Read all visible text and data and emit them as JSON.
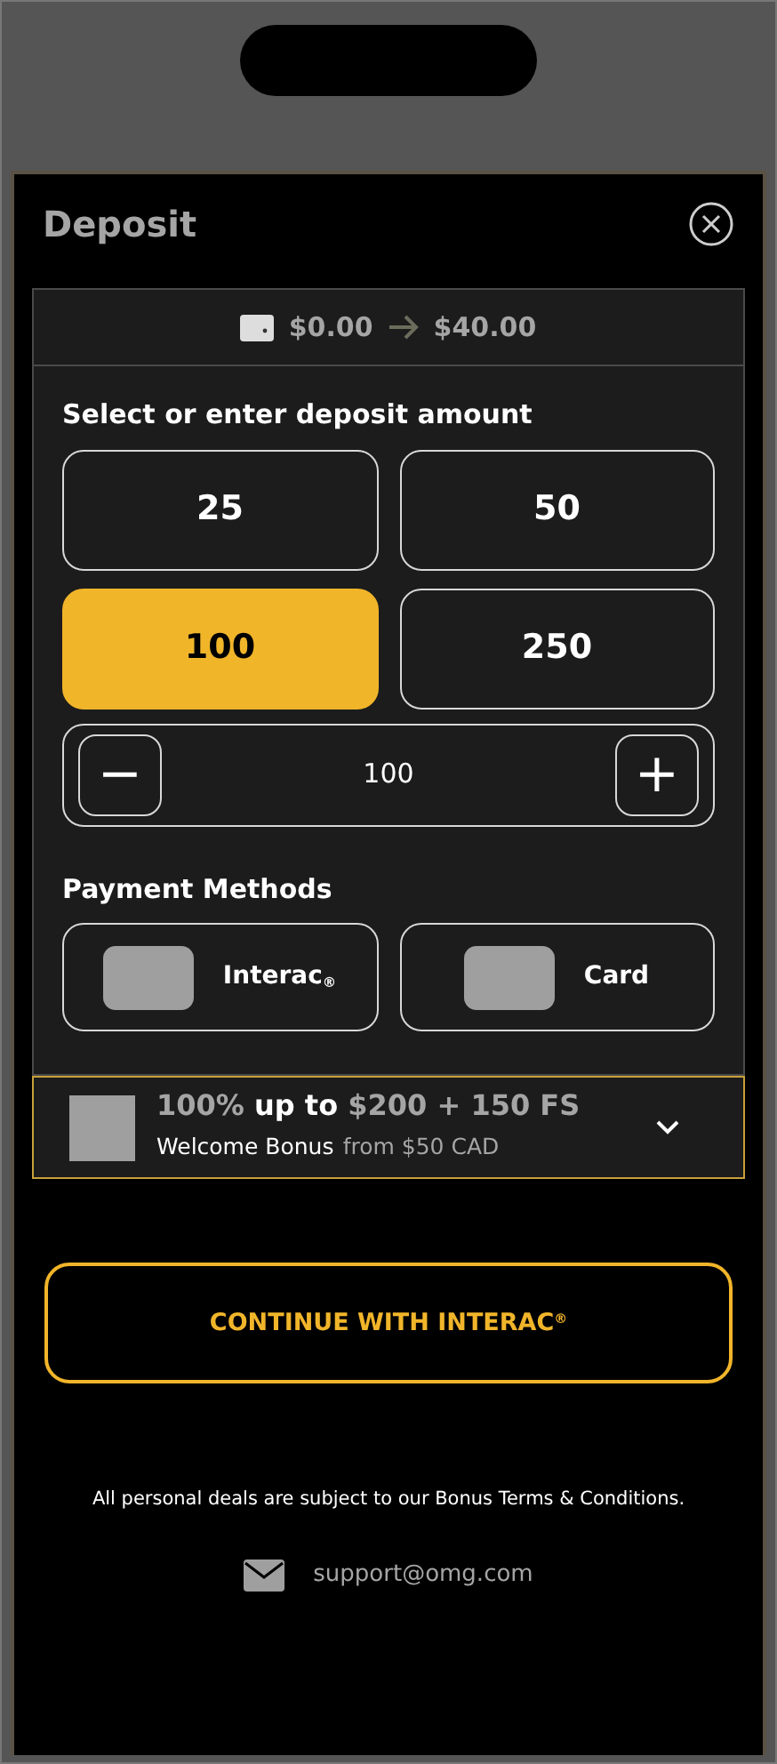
{
  "title": "Deposit",
  "balance": {
    "from": "$0.00",
    "to": "$40.00"
  },
  "amount_label": "Select or enter deposit amount",
  "amounts": [
    {
      "label": "25",
      "selected": false
    },
    {
      "label": "50",
      "selected": false
    },
    {
      "label": "100",
      "selected": true
    },
    {
      "label": "250",
      "selected": false
    }
  ],
  "stepper": {
    "minus": "−",
    "value": "100",
    "plus": "+"
  },
  "payment_label": "Payment Methods",
  "methods": [
    {
      "label": "Interac$_{®}$"
    },
    {
      "label": "Card"
    }
  ],
  "bonus": {
    "headline": "100% **up to** $200 + 150 FS",
    "subtitle": "Welcome Bonus",
    "condition": "from $50 CAD",
    "expanded": false
  },
  "continue_button": "CONTINUE WITH INTERAC$^{®}$",
  "terms": "All personal deals  are subject to our Bonus Terms & Conditions.",
  "support_email": "support@omg.com"
}
